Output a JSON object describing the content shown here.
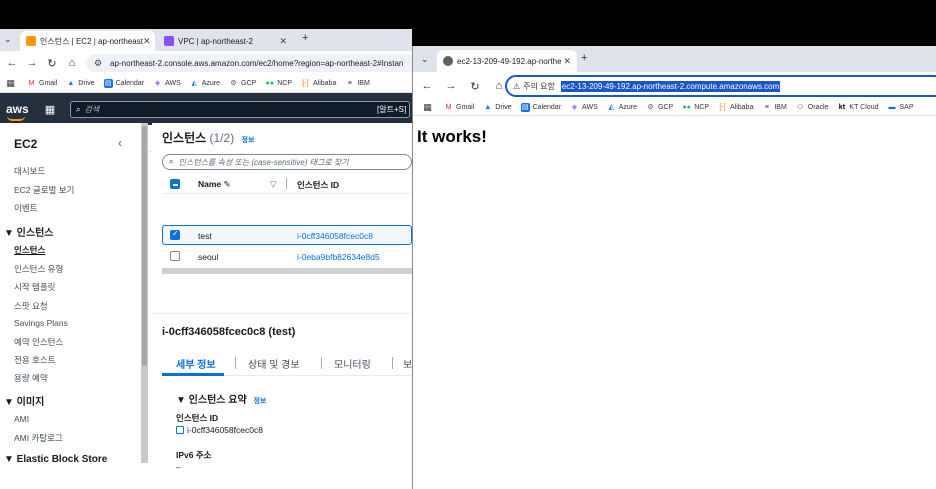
{
  "window1": {
    "tabs": [
      {
        "label": "인스턴스 | EC2 | ap-northeast",
        "close": "✕"
      },
      {
        "label": "VPC | ap-northeast-2",
        "close": "✕"
      }
    ],
    "new_tab": "+",
    "url": "ap-northeast-2.console.aws.amazon.com/ec2/home?region=ap-northeast-2#Instan",
    "bookmarks": [
      "Gmail",
      "Drive",
      "Calendar",
      "AWS",
      "Azure",
      "GCP",
      "NCP",
      "Alibaba",
      "IBM"
    ],
    "aws": {
      "logo": "aws",
      "search_placeholder": "검색",
      "search_hint": "[알트+S]"
    },
    "sidebar": {
      "title": "EC2",
      "collapse": "‹",
      "items_top": [
        "대시보드",
        "EC2 글로벌 보기",
        "이벤트"
      ],
      "section_instances": "▼ 인스턴스",
      "instances_items": [
        "인스턴스",
        "인스턴스 유형",
        "시작 템플릿",
        "스팟 요청",
        "Savings Plans",
        "예약 인스턴스",
        "전용 호스트",
        "용량 예약"
      ],
      "section_images": "▼ 이미지",
      "images_items": [
        "AMI",
        "AMI 카탈로그"
      ],
      "section_ebs": "▼ Elastic Block Store"
    },
    "main": {
      "title": "인스턴스",
      "count": "(1/2)",
      "info": "정보",
      "search_placeholder": "인스턴스를 속성 또는 (case-sensitive) 태그로 찾기",
      "col_name": "Name ✎",
      "col_sort": "▽",
      "col_id": "인스턴스 ID",
      "rows": [
        {
          "name": "test",
          "id": "i-0cff346058fcec0c8"
        },
        {
          "name": "seoul",
          "id": "i-0eba9bfb82634e8d5"
        }
      ]
    },
    "details": {
      "title": "i-0cff346058fcec0c8 (test)",
      "tabs": [
        "세부 정보",
        "상태 및 경보",
        "모니터링",
        "보"
      ],
      "summary": "▼ 인스턴스 요약",
      "summary_info": "정보",
      "id_label": "인스턴스 ID",
      "id_value": "i-0cff346058fcec0c8",
      "ipv6_label": "IPv6 주소",
      "ipv6_value": "–"
    }
  },
  "window2": {
    "tab_label": "ec2-13-209-49-192.ap-northe",
    "tab_close": "✕",
    "new_tab": "+",
    "warn": "주의 요함",
    "url": "ec2-13-209-49-192.ap-northeast-2.compute.amazonaws.com",
    "bookmarks": [
      "Gmail",
      "Drive",
      "Calendar",
      "AWS",
      "Azure",
      "GCP",
      "NCP",
      "Alibaba",
      "IBM",
      "Oracle",
      "KT Cloud",
      "SAP"
    ],
    "content": "It works!"
  }
}
